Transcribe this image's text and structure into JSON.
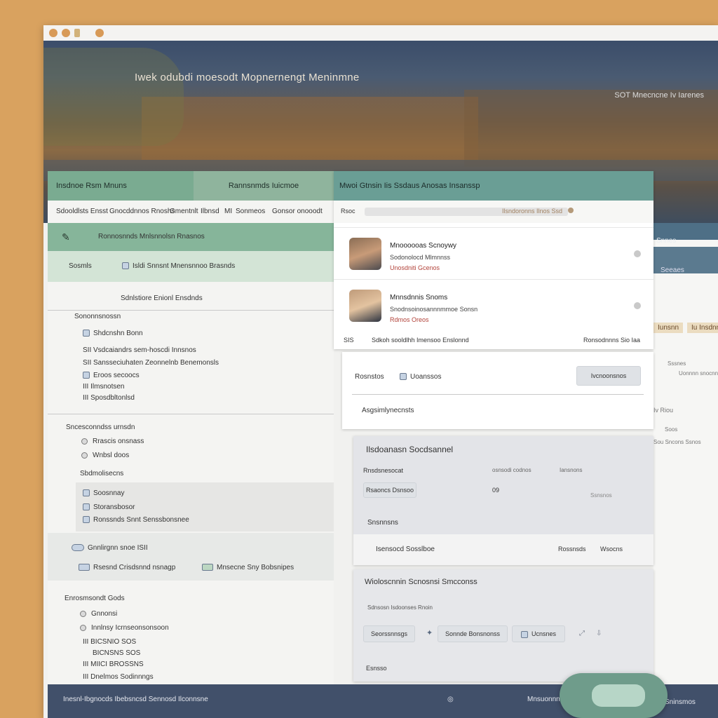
{
  "window": {
    "dots": [
      "close",
      "minimize",
      "maximize",
      "pin"
    ]
  },
  "banner": {
    "title": "Iwek odubdi moesodt Mopnernengt Meninmne",
    "right_text": "SOT Mnecncne Iv Iarenes"
  },
  "left": {
    "header_a": "Insdnoe Rsm Mnuns",
    "header_b": "Rannsnmds Iuicmoe",
    "filters": [
      "Sdooldlsts Ensst",
      "Gnocddnnos Rnoshs",
      "Gmentnlt",
      "Ilbnsd",
      "MI",
      "Sonmeos",
      "Gonsor onooodt"
    ],
    "greenbar_text": "Ronnosnnds Mnlsnnolsn Rnasnos",
    "lightgreen_label": "Sosmls",
    "lightgreen_text": "Isldi Snnsnt Mnensnnoo Brasnds",
    "subtitle": "Sdnlstiore Enionl Ensdnds",
    "section1_title": "Sononnsnossn",
    "section1_items": [
      "Shdcnshn Bonn",
      "Vsdcaiandrs sem-hoscdi Innsnos",
      "Sansseciuhaten Zeonnelnb Benemonsls",
      "Eroos secoocs",
      "Ilmsnotsen",
      "Sposdbltonlsd"
    ],
    "section1_prefix": [
      "",
      "III",
      "SII",
      "",
      "III",
      "III"
    ],
    "section2_title": "Sncesconndss urnsdn",
    "section2_radios": [
      "Rrascis onsnass",
      "Wnbsl doos"
    ],
    "section3_title": "Sbdmolisecns",
    "section3_items": [
      "Soosnnay",
      "Storansbosor",
      "Ronssnds Snnt Senssbonsnee"
    ],
    "settings_row1": "Gnnlirgnn snoe ISII",
    "settings_row2a": "Rsesnd Crisdsnnd nsnagp",
    "settings_row2b": "Mnsecne Sny Bobsnipes",
    "bottom_title": "Enrosmsondt Gods",
    "bottom_items": [
      "Gnnonsi",
      "Innlnsy Icrnseonsonsoon",
      "BICSNIO SOS",
      "BICNSNS SOS",
      "MIICI BROSSNS",
      "Dnelmos Sodinnngs"
    ],
    "bottom_prefix": [
      "",
      "",
      "III",
      "",
      "III",
      "III"
    ]
  },
  "contacts": {
    "header": "Mwoi Gtnsin Iis Ssdaus Anosas Insanssp",
    "search_prefix": "Rsoc",
    "search_placeholder": "Ilsndoronns Ilnos Ssd",
    "items": [
      {
        "name": "Mnoooooas Scnoywy",
        "sub": "Sodonolocd Mlmnnss",
        "link": "Unosdniti Gcenos"
      },
      {
        "name": "Mnnsdnnis Snoms",
        "sub": "Snodnsoinosannnmmoe Sonsn",
        "link": "Rdmos Oreos"
      }
    ],
    "footer_left": "SIS",
    "footer_mid": "Sdkoh sooldlhh Imensoo Enslonnd",
    "footer_right": "Ronsodnnns Sio Iaa"
  },
  "card2": {
    "label": "Rosnstos",
    "item": "Uoanssos",
    "button": "Ivcnoonsnos",
    "sub": "Asgsimlynecnsts"
  },
  "card3": {
    "title": "Ilsdoanasn Socdsannel",
    "col1": "Rnsdsnesocat",
    "col2": "osnsodi codnos",
    "col3": "Iansnons",
    "button": "Rsaoncs Dsnsoo",
    "value": "09",
    "right_val": "Ssnsnos",
    "row_label": "Snsnnsns",
    "bottom_left": "Isensocd Sosslboe",
    "bottom_mid": "Rossnsds",
    "bottom_right": "Wsocns"
  },
  "card4": {
    "title": "Wioloscnnin Scnosnsi Smcconss",
    "sub": "Sdnsosn Isdoonses Rnoin",
    "btn1": "Seorssnnsgs",
    "btn2": "Sonnde Bonsnonss",
    "btn3": "Ucnsnes",
    "footer": "Esnsso"
  },
  "right": {
    "label1": "Snnes",
    "label2": "Seeaes",
    "tag1": "Iunsnn",
    "tag2": "Iu Insdnns",
    "t1": "Sssnes",
    "t2": "Uonnnn snocnnos",
    "t3": "Iv Riou",
    "t4": "Soos",
    "t5": "Sou Sncons Ssnos"
  },
  "footer": {
    "left": "Inesnl-Ibgnocds Ibebsncsd Sennosd Ilconnsne",
    "right": "Mnsuonnnrinn",
    "far_right": "Sninsmos"
  }
}
